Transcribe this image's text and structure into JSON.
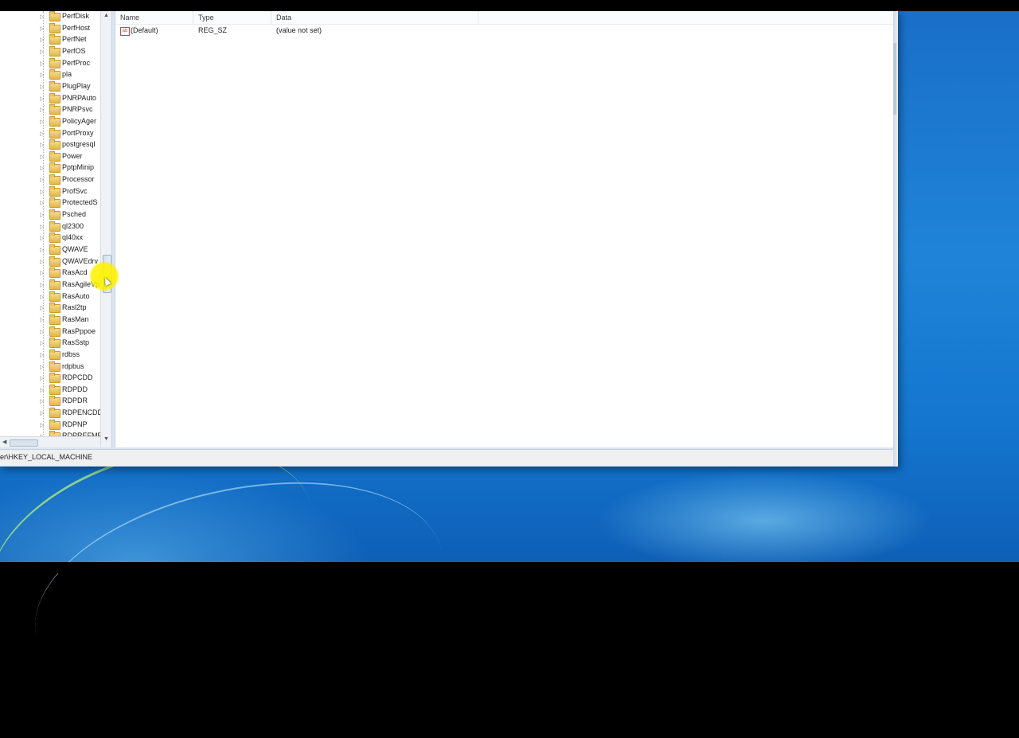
{
  "tree": {
    "items": [
      {
        "label": "PerfDisk"
      },
      {
        "label": "PerfHost"
      },
      {
        "label": "PerfNet"
      },
      {
        "label": "PerfOS"
      },
      {
        "label": "PerfProc"
      },
      {
        "label": "pla"
      },
      {
        "label": "PlugPlay"
      },
      {
        "label": "PNRPAuto"
      },
      {
        "label": "PNRPsvc"
      },
      {
        "label": "PolicyAger"
      },
      {
        "label": "PortProxy"
      },
      {
        "label": "postgresql"
      },
      {
        "label": "Power"
      },
      {
        "label": "PptpMinip"
      },
      {
        "label": "Processor"
      },
      {
        "label": "ProfSvc"
      },
      {
        "label": "ProtectedS"
      },
      {
        "label": "Psched"
      },
      {
        "label": "ql2300"
      },
      {
        "label": "ql40xx"
      },
      {
        "label": "QWAVE"
      },
      {
        "label": "QWAVEdrv"
      },
      {
        "label": "RasAcd"
      },
      {
        "label": "RasAgileVp"
      },
      {
        "label": "RasAuto"
      },
      {
        "label": "Rasl2tp"
      },
      {
        "label": "RasMan"
      },
      {
        "label": "RasPppoe"
      },
      {
        "label": "RasSstp"
      },
      {
        "label": "rdbss"
      },
      {
        "label": "rdpbus"
      },
      {
        "label": "RDPCDD"
      },
      {
        "label": "RDPDD"
      },
      {
        "label": "RDPDR"
      },
      {
        "label": "RDPENCDD"
      },
      {
        "label": "RDPNP"
      },
      {
        "label": "RDPREFMP"
      }
    ]
  },
  "values": {
    "headers": {
      "name": "Name",
      "type": "Type",
      "data": "Data"
    },
    "rows": [
      {
        "name": "(Default)",
        "type": "REG_SZ",
        "data": "(value not set)",
        "icon": "string-value-icon"
      }
    ]
  },
  "statusbar": {
    "path": "er\\HKEY_LOCAL_MACHINE"
  },
  "icons": {
    "folder": "folder-icon",
    "expander": "expand-arrow-icon",
    "string_value": "string-value-icon"
  },
  "colors": {
    "highlight": "#fff200",
    "desktop": "#1f84d8"
  }
}
